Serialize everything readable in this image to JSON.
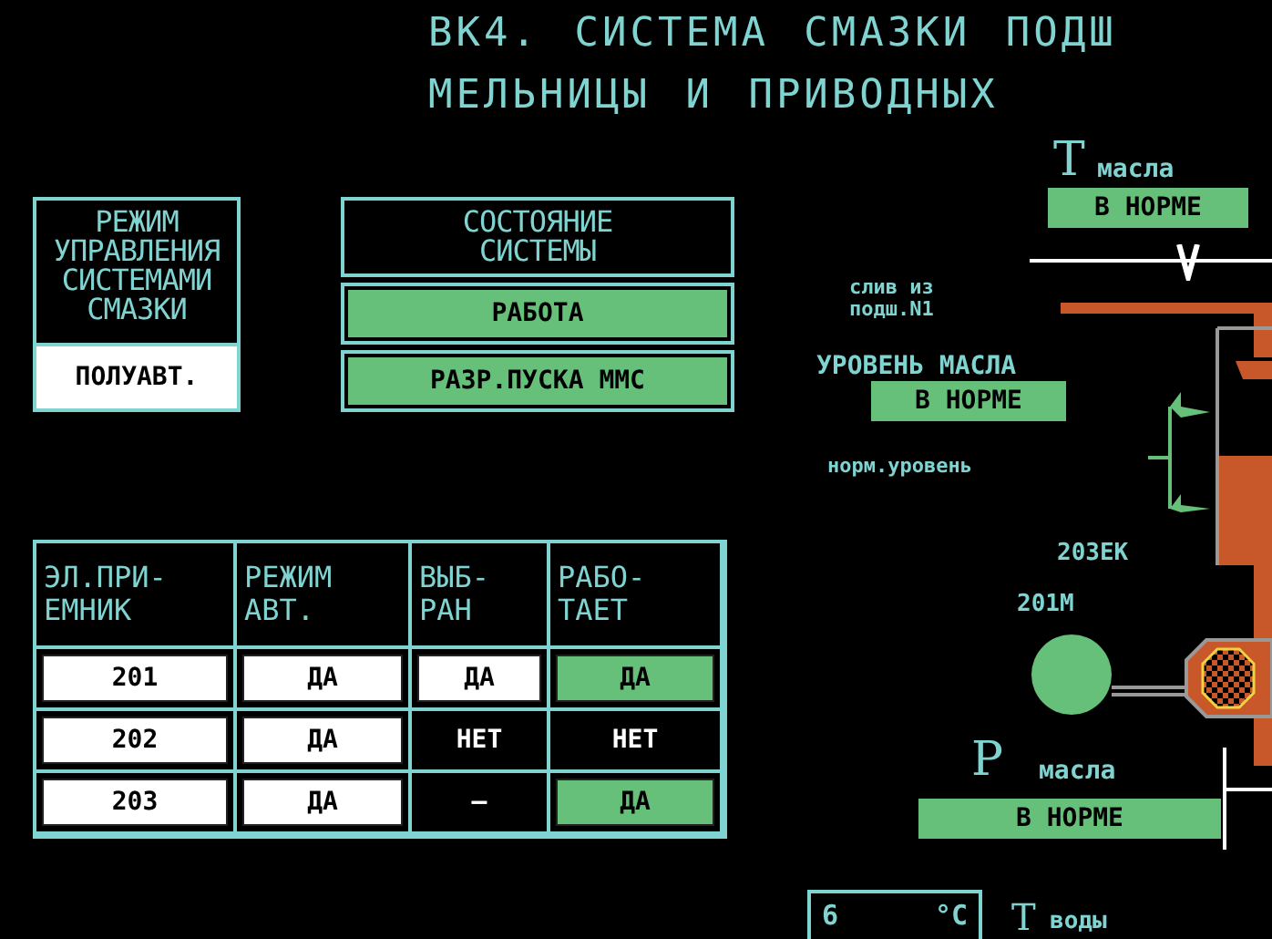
{
  "title_lines": [
    "ВК4. СИСТЕМА СМАЗКИ ПОДШ",
    "МЕЛЬНИЦЫ И ПРИВОДНЫХ"
  ],
  "control_mode": {
    "heading_lines": [
      "РЕЖИМ",
      "УПРАВЛЕНИЯ",
      "СИСТЕМАМИ",
      "СМАЗКИ"
    ],
    "value": "ПОЛУАВТ."
  },
  "system_state": {
    "heading_lines": [
      "СОСТОЯНИЕ",
      "СИСТЕМЫ"
    ],
    "indicators": [
      {
        "text": "РАБОТА",
        "kind": "green"
      },
      {
        "text": "РАЗР.ПУСКА ММС",
        "kind": "green"
      }
    ]
  },
  "table": {
    "columns": [
      "ЭЛ.ПРИ-\nЕМНИК",
      "РЕЖИМ\nАВТ.",
      "ВЫБ-\nРАН",
      "РАБО-\nТАЕТ"
    ],
    "rows": [
      [
        {
          "text": "201",
          "kind": "white"
        },
        {
          "text": "ДА",
          "kind": "white"
        },
        {
          "text": "ДА",
          "kind": "white"
        },
        {
          "text": "ДА",
          "kind": "green"
        }
      ],
      [
        {
          "text": "202",
          "kind": "white"
        },
        {
          "text": "ДА",
          "kind": "white"
        },
        {
          "text": "НЕТ",
          "kind": "plain"
        },
        {
          "text": "НЕТ",
          "kind": "plain"
        }
      ],
      [
        {
          "text": "203",
          "kind": "white"
        },
        {
          "text": "ДА",
          "kind": "white"
        },
        {
          "text": "—",
          "kind": "plain"
        },
        {
          "text": "ДА",
          "kind": "green"
        }
      ]
    ]
  },
  "diagram": {
    "oil_temp": {
      "symbol": "Т",
      "label": "масла",
      "status": "В НОРМЕ"
    },
    "drain_label_lines": [
      "слив из",
      "подш.N1"
    ],
    "oil_level": {
      "label": "УРОВЕНЬ МАСЛА",
      "status": "В НОРМЕ"
    },
    "normal_level_label": "норм.уровень",
    "heater_label": "203ЕК",
    "motor_label": "201М",
    "oil_pressure": {
      "symbol": "Р",
      "label": "масла",
      "status": "В НОРМЕ"
    },
    "water_temp": {
      "value": "6",
      "unit": "°С",
      "symbol": "Т",
      "label": "воды"
    }
  }
}
